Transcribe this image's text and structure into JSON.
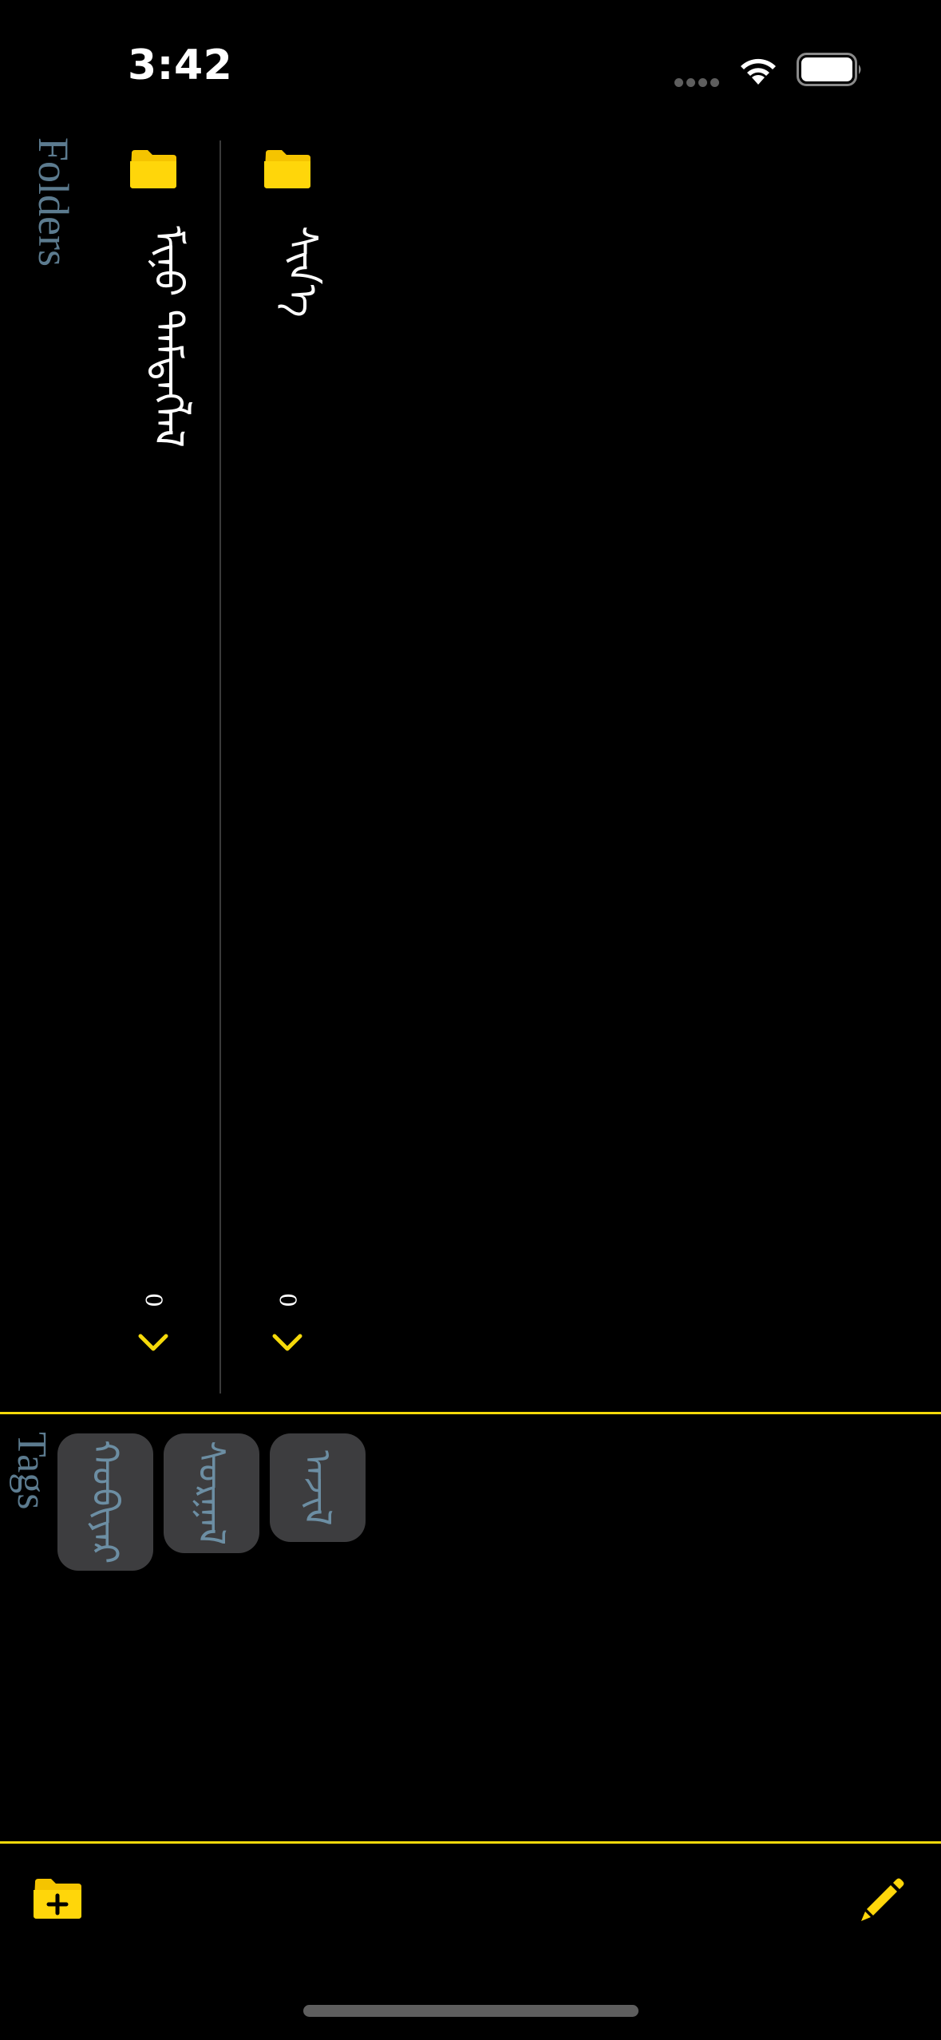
{
  "status_bar": {
    "time": "3:42"
  },
  "folders": {
    "title": "Folders",
    "items": [
      {
        "name": "ᠮᠢᠨᠦ ᠲᠡᠮᠳᠡᠭᠯᠡᠯ",
        "count": "0"
      },
      {
        "name": "ᠰᠢᠨ᠎ᠡ",
        "count": "0"
      }
    ]
  },
  "tags": {
    "title": "Tags",
    "items": [
      {
        "label": "ᠬᠤᠪᠢᠶᠠᠷ"
      },
      {
        "label": "ᠰᠤᠷᠭᠠᠯ"
      },
      {
        "label": "ᠠᠵᠢᠯ"
      }
    ]
  },
  "colors": {
    "accent": "#f5d90a",
    "title_text": "#5c7b8f",
    "tag_bg": "#3d3d3f"
  },
  "icons": {
    "new_folder": "folder-plus-icon",
    "compose": "pencil-icon"
  }
}
